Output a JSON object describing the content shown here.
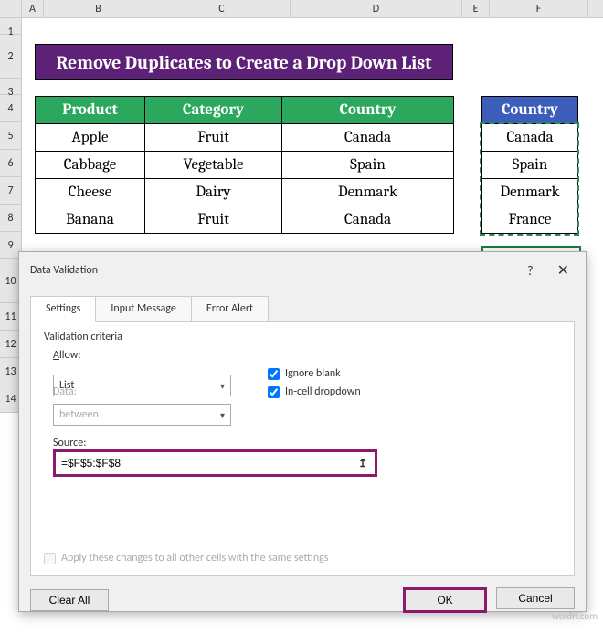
{
  "columns": [
    "A",
    "B",
    "C",
    "D",
    "E",
    "F"
  ],
  "rows": [
    "1",
    "2",
    "3",
    "4",
    "5",
    "6",
    "7",
    "8",
    "9",
    "10",
    "11",
    "12",
    "13",
    "14"
  ],
  "banner": "Remove Duplicates to Create a Drop Down List",
  "table": {
    "headers": [
      "Product",
      "Category",
      "Country"
    ],
    "rows": [
      [
        "Apple",
        "Fruit",
        "Canada"
      ],
      [
        "Cabbage",
        "Vegetable",
        "Spain"
      ],
      [
        "Cheese",
        "Dairy",
        "Denmark"
      ],
      [
        "Banana",
        "Fruit",
        "Canada"
      ]
    ]
  },
  "country": {
    "header": "Country",
    "rows": [
      "Canada",
      "Spain",
      "Denmark",
      "France"
    ]
  },
  "dialog": {
    "title": "Data Validation",
    "help": "?",
    "close": "✕",
    "tabs": {
      "settings": "Settings",
      "input": "Input Message",
      "error": "Error Alert"
    },
    "criteria_label": "Validation criteria",
    "allow_label_pre": "A",
    "allow_label_post": "llow:",
    "allow_value": "List",
    "data_label_pre": "D",
    "data_label_post": "ata:",
    "data_value": "between",
    "ignore_blank_pre": "Ignore ",
    "ignore_blank_u": "b",
    "ignore_blank_post": "lank",
    "incell_pre": "I",
    "incell_post": "n-cell dropdown",
    "source_label_pre": "S",
    "source_label_post": "ource:",
    "source_value": "=$F$5:$F$8",
    "collapse": "↥",
    "apply_pre": "Apply these changes to all other cells with the same settings",
    "clear_pre": "C",
    "clear_post": "lear All",
    "ok": "OK",
    "cancel": "Cancel"
  },
  "watermark": "wsxdn.com"
}
